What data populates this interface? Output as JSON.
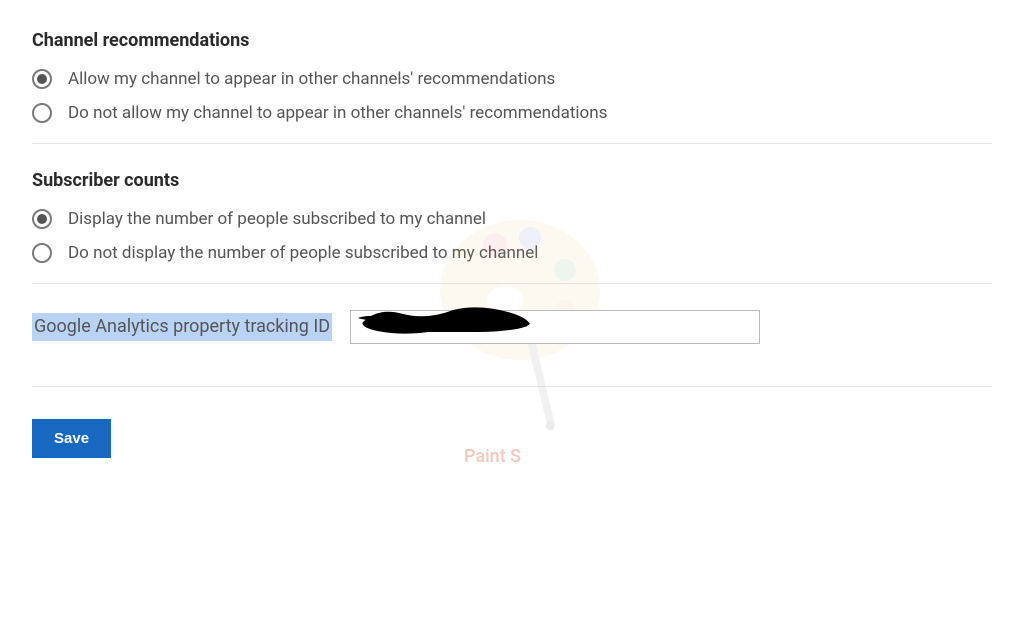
{
  "sections": {
    "channel_recommendations": {
      "title": "Channel recommendations",
      "options": [
        {
          "label": "Allow my channel to appear in other channels' recommendations",
          "selected": true
        },
        {
          "label": "Do not allow my channel to appear in other channels' recommendations",
          "selected": false
        }
      ]
    },
    "subscriber_counts": {
      "title": "Subscriber counts",
      "options": [
        {
          "label": "Display the number of people subscribed to my channel",
          "selected": true
        },
        {
          "label": "Do not display the number of people subscribed to my channel",
          "selected": false
        }
      ]
    },
    "google_analytics": {
      "label": "Google Analytics property tracking ID",
      "value": ""
    }
  },
  "buttons": {
    "save": "Save"
  },
  "watermark": {
    "text": "Paint S"
  }
}
